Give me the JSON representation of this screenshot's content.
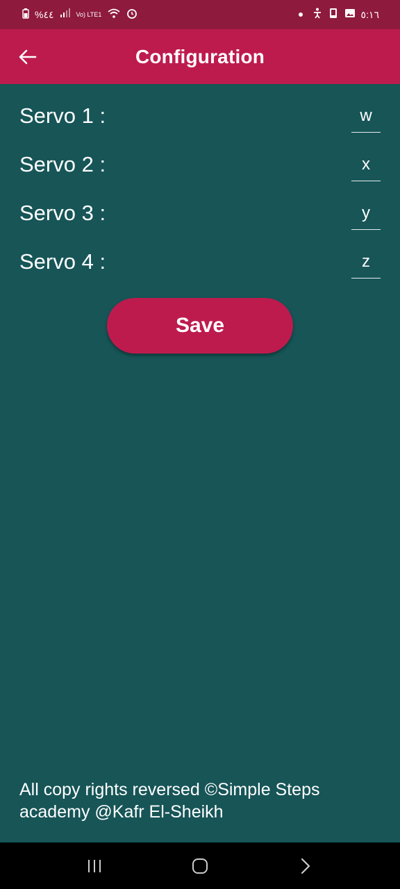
{
  "status_bar": {
    "left_text": "%٤٤",
    "network": "Vo) LTE1",
    "time": "٥:١٦"
  },
  "app_bar": {
    "title": "Configuration"
  },
  "servos": [
    {
      "label": "Servo 1 :",
      "value": "w"
    },
    {
      "label": "Servo 2 :",
      "value": "x"
    },
    {
      "label": "Servo 3 :",
      "value": "y"
    },
    {
      "label": "Servo 4 :",
      "value": "z"
    }
  ],
  "actions": {
    "save_label": "Save"
  },
  "footer": {
    "text": "All copy rights reversed ©Simple Steps academy  @Kafr El-Sheikh"
  },
  "colors": {
    "status_bar": "#8e1a3e",
    "app_bar": "#bd1b4e",
    "background": "#175557",
    "accent": "#bd1b4e"
  }
}
